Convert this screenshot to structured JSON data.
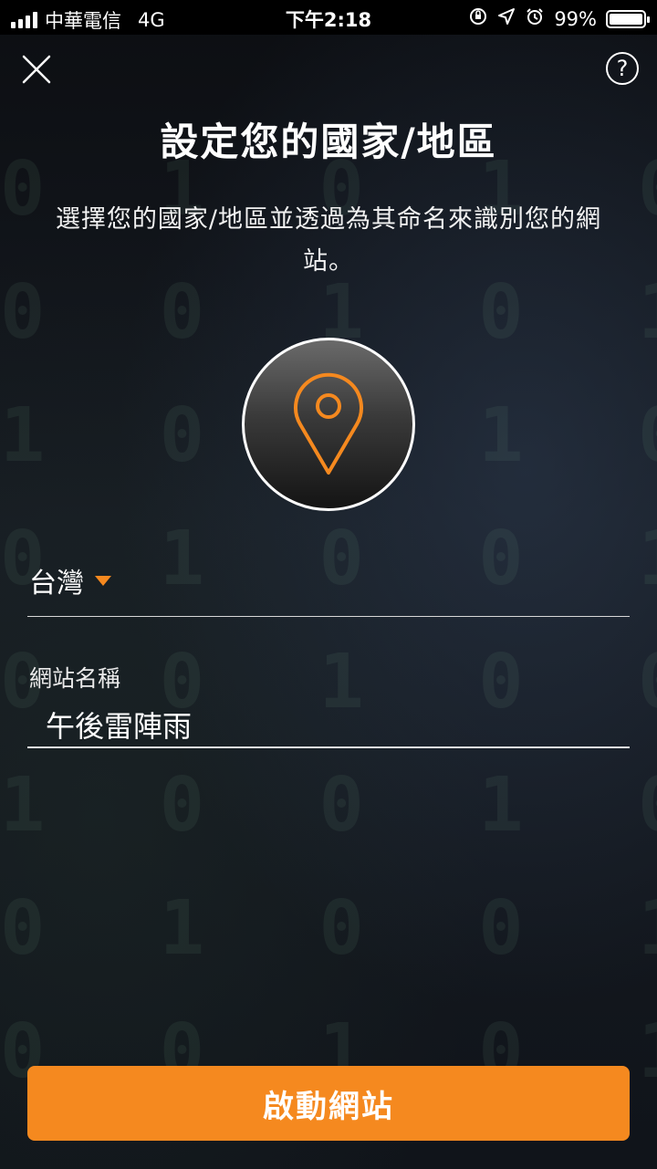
{
  "status_bar": {
    "carrier": "中華電信",
    "network": "4G",
    "time": "下午2:18",
    "battery": "99%",
    "battery_level": 0.99
  },
  "header": {
    "close_icon": "close-icon",
    "help_label": "?"
  },
  "title": "設定您的國家/地區",
  "description": "選擇您的國家/地區並透過為其命名來識別您的網站。",
  "country": {
    "selected": "台灣"
  },
  "site_name": {
    "label": "網站名稱",
    "value": "午後雷陣雨"
  },
  "start_button": {
    "label": "啟動網站"
  },
  "colors": {
    "accent": "#f5891f",
    "background": "#111418"
  }
}
